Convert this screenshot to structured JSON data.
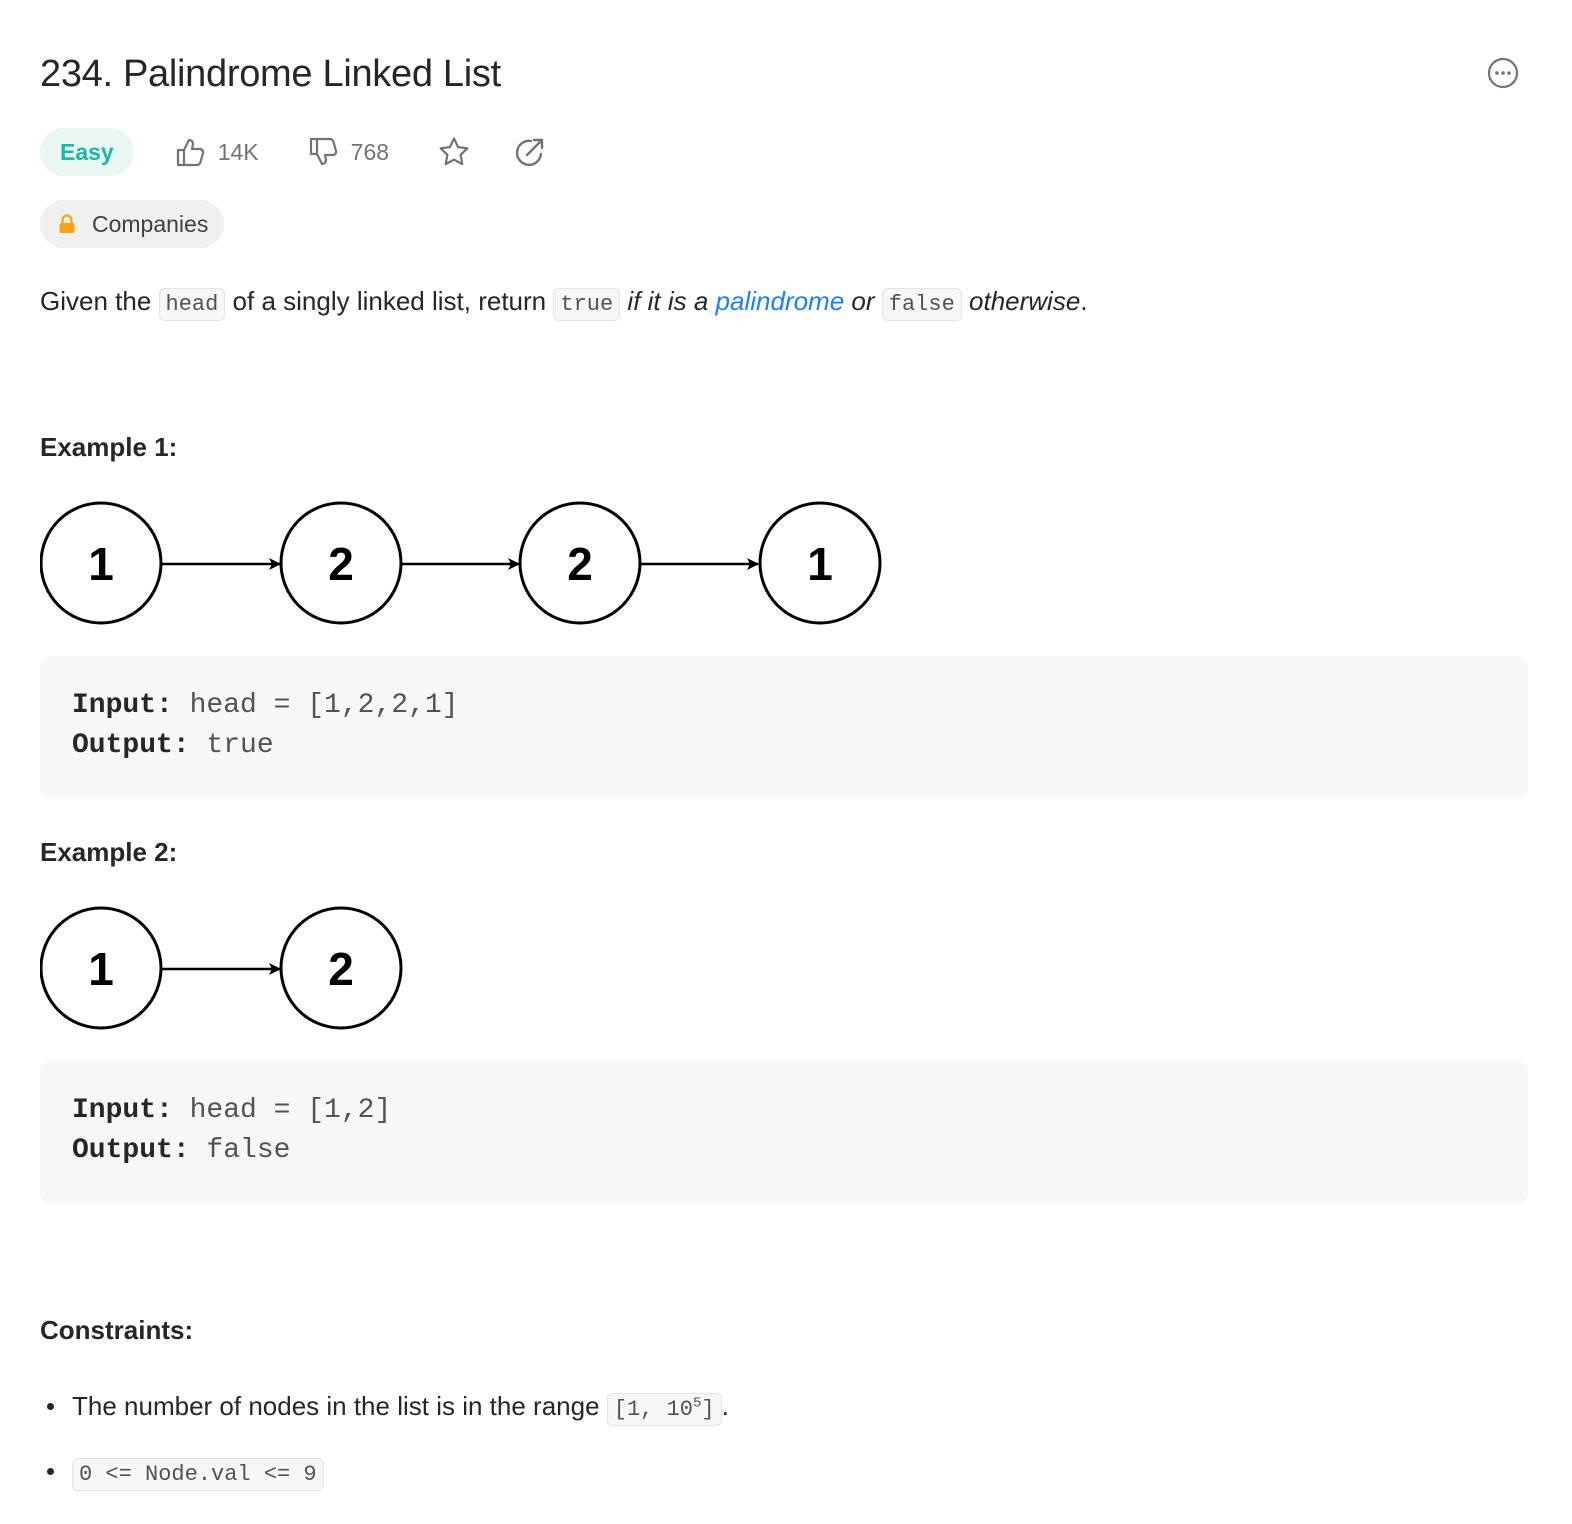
{
  "problem": {
    "number_title": "234. Palindrome Linked List",
    "difficulty": "Easy",
    "likes": "14K",
    "dislikes": "768",
    "companies_label": "Companies"
  },
  "description": {
    "p1": "Given the ",
    "code_head": "head",
    "p2": " of a singly linked list, return ",
    "code_true": "true",
    "p3": " if it is a ",
    "link_palindrome": "palindrome",
    "p4": " or ",
    "code_false": "false",
    "p5": " otherwise",
    "p6": "."
  },
  "examples": [
    {
      "heading": "Example 1:",
      "nodes": [
        "1",
        "2",
        "2",
        "1"
      ],
      "input_label": "Input:",
      "input_value": " head = [1,2,2,1]",
      "output_label": "Output:",
      "output_value": " true"
    },
    {
      "heading": "Example 2:",
      "nodes": [
        "1",
        "2"
      ],
      "input_label": "Input:",
      "input_value": " head = [1,2]",
      "output_label": "Output:",
      "output_value": " false"
    }
  ],
  "constraints": {
    "heading": "Constraints:",
    "item1_text": "The number of nodes in the list is in the range ",
    "item1_code_a": "[1, 10",
    "item1_sup": "5",
    "item1_code_b": "]",
    "item1_end": ".",
    "item2_code": "0 <= Node.val <= 9"
  },
  "colors": {
    "difficulty_easy": "#1cb8a5",
    "link": "#1a80ff",
    "lock": "#ffa116"
  },
  "icons": [
    "thumbs-up-icon",
    "thumbs-down-icon",
    "star-icon",
    "share-icon",
    "lock-icon",
    "more-icon"
  ]
}
